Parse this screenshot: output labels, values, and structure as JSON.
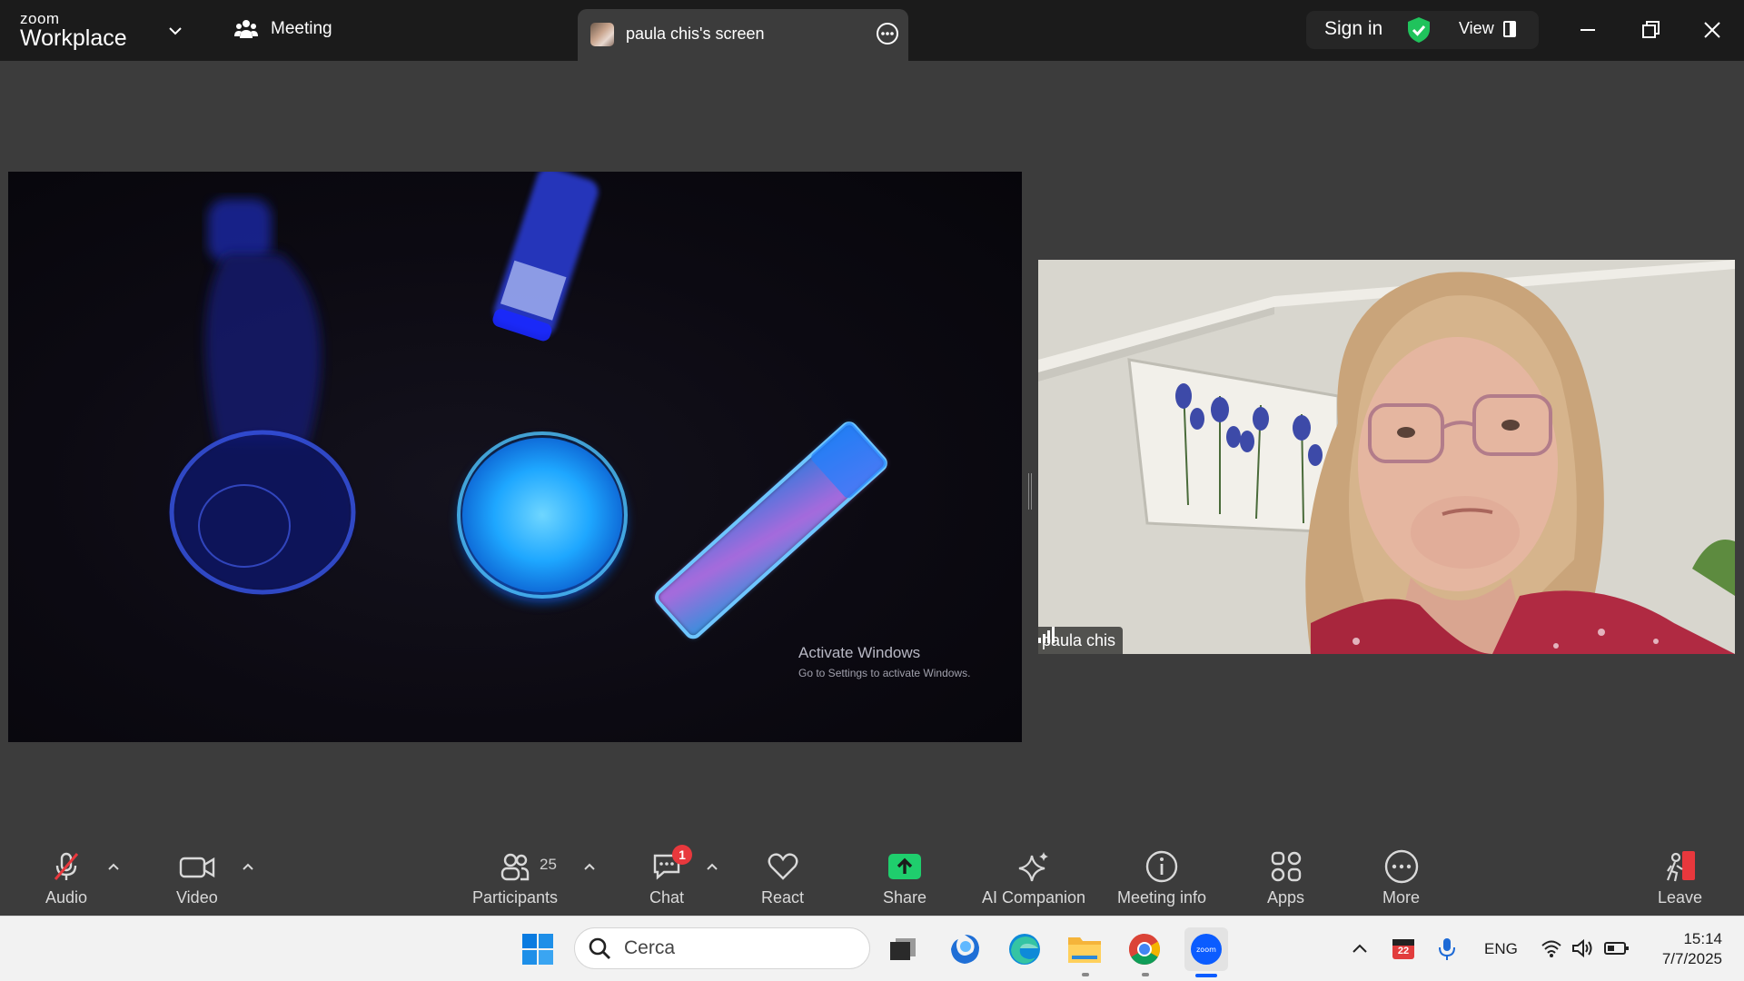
{
  "titlebar": {
    "logo_line1": "zoom",
    "logo_line2": "Workplace",
    "meeting_label": "Meeting",
    "screen_tab_title": "paula chis's screen",
    "sign_in": "Sign in",
    "view_label": "View"
  },
  "shared_screen": {
    "watermark_title": "Activate Windows",
    "watermark_sub": "Go to Settings to activate Windows."
  },
  "participant": {
    "name": "paula chis"
  },
  "toolbar": {
    "audio": "Audio",
    "video": "Video",
    "participants": "Participants",
    "participants_count": "25",
    "chat": "Chat",
    "chat_badge": "1",
    "react": "React",
    "share": "Share",
    "ai_companion": "AI Companion",
    "meeting_info": "Meeting info",
    "apps": "Apps",
    "more": "More",
    "leave": "Leave"
  },
  "taskbar": {
    "search_placeholder": "Cerca",
    "language": "ENG",
    "time": "15:14",
    "date": "7/7/2025",
    "calendar_badge": "22"
  },
  "colors": {
    "share_green": "#1fce6d",
    "shield_green": "#20c35c",
    "leave_red": "#e8383d",
    "zoom_blue": "#0b5cff",
    "glow_blue": "#2fa8ff"
  }
}
